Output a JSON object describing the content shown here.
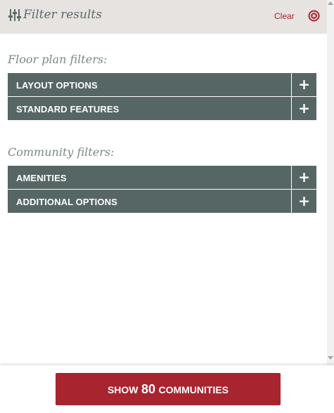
{
  "header": {
    "title": "Filter results",
    "clear_label": "Clear",
    "icon": "sliders-icon",
    "close_icon": "close-circle-icon"
  },
  "sections": [
    {
      "heading": "Floor plan filters:",
      "items": [
        {
          "label": "LAYOUT OPTIONS",
          "toggle": "+"
        },
        {
          "label": "STANDARD FEATURES",
          "toggle": "+"
        }
      ]
    },
    {
      "heading": "Community filters:",
      "items": [
        {
          "label": "AMENITIES",
          "toggle": "+"
        },
        {
          "label": "ADDITIONAL OPTIONS",
          "toggle": "+"
        }
      ]
    }
  ],
  "footer": {
    "button_prefix": "SHOW",
    "count": "80",
    "button_suffix": "COMMUNITIES"
  },
  "colors": {
    "accent": "#a8242e",
    "accordion_bg": "#566664",
    "header_bg": "#e6e3e1",
    "heading_text": "#7a8886"
  }
}
